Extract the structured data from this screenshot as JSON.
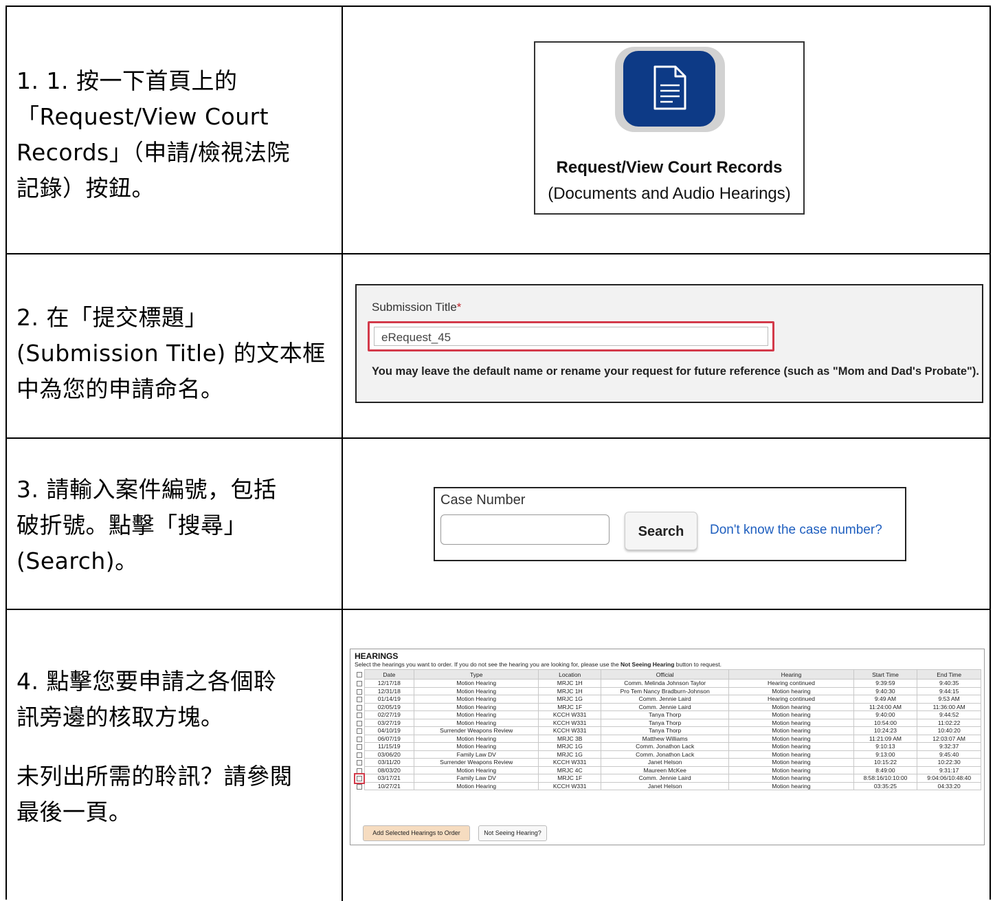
{
  "steps": [
    {
      "lines": [
        "1.  1. 按一下首頁上的",
        "「Request/View Court",
        "Records」（申請/檢視法院",
        "記錄）按鈕。"
      ]
    },
    {
      "lines": [
        "2.   在「提交標題」",
        "(Submission Title) 的文本框",
        "中為您的申請命名。"
      ]
    },
    {
      "lines": [
        "3.   請輸入案件編號，包括",
        "破折號。點擊「搜尋」",
        "(Search)。"
      ]
    },
    {
      "lines": [
        "4.   點擊您要申請之各個聆",
        "訊旁邊的核取方塊。"
      ],
      "lines2": [
        "未列出所需的聆訊？請參閱",
        "最後一頁。"
      ]
    }
  ],
  "request_view": {
    "icon": "document-icon",
    "title": "Request/View Court Records",
    "subtitle": "(Documents and Audio Hearings)"
  },
  "submission": {
    "label": "Submission Title",
    "required_mark": "*",
    "value": "eRequest_45",
    "help": "You may leave the default name or rename your request for future reference (such as \"Mom and Dad's Probate\")."
  },
  "case_search": {
    "label": "Case Number",
    "input_value": "",
    "search_button": "Search",
    "help_link": "Don't know the case number?"
  },
  "hearings": {
    "title": "HEARINGS",
    "desc_before": "Select the hearings you want to order. If you do not see the hearing you are looking for, please use the ",
    "desc_bold": "Not Seeing Hearing",
    "desc_after": " button to request.",
    "columns": [
      "Date",
      "Type",
      "Location",
      "Official",
      "Hearing",
      "Start Time",
      "End Time"
    ],
    "rows": [
      [
        "12/17/18",
        "Motion Hearing",
        "MRJC 1H",
        "Comm. Melinda Johnson Taylor",
        "Hearing continued",
        "9:39:59",
        "9:40:35"
      ],
      [
        "12/31/18",
        "Motion Hearing",
        "MRJC 1H",
        "Pro Tem Nancy Bradburn-Johnson",
        "Motion hearing",
        "9:40:30",
        "9:44:15"
      ],
      [
        "01/14/19",
        "Motion Hearing",
        "MRJC 1G",
        "Comm. Jennie Laird",
        "Hearing continued",
        "9:49 AM",
        "9:53 AM"
      ],
      [
        "02/05/19",
        "Motion Hearing",
        "MRJC 1F",
        "Comm. Jennie Laird",
        "Motion hearing",
        "11:24:00 AM",
        "11:36:00 AM"
      ],
      [
        "02/27/19",
        "Motion Hearing",
        "KCCH W331",
        "Tanya Thorp",
        "Motion hearing",
        "9:40:00",
        "9:44:52"
      ],
      [
        "03/27/19",
        "Motion Hearing",
        "KCCH W331",
        "Tanya Thorp",
        "Motion hearing",
        "10:54:00",
        "11:02:22"
      ],
      [
        "04/10/19",
        "Surrender Weapons Review",
        "KCCH W331",
        "Tanya Thorp",
        "Motion hearing",
        "10:24:23",
        "10:40:20"
      ],
      [
        "06/07/19",
        "Motion Hearing",
        "MRJC 3B",
        "Matthew Williams",
        "Motion hearing",
        "11:21:09 AM",
        "12:03:07 AM"
      ],
      [
        "11/15/19",
        "Motion Hearing",
        "MRJC 1G",
        "Comm. Jonathon Lack",
        "Motion hearing",
        "9:10:13",
        "9:32:37"
      ],
      [
        "03/06/20",
        "Family Law DV",
        "MRJC 1G",
        "Comm. Jonathon Lack",
        "Motion hearing",
        "9:13:00",
        "9:45:40"
      ],
      [
        "03/11/20",
        "Surrender Weapons Review",
        "KCCH W331",
        "Janet Helson",
        "Motion hearing",
        "10:15:22",
        "10:22:30"
      ],
      [
        "08/03/20",
        "Motion Hearing",
        "MRJC 4C",
        "Maureen McKee",
        "Motion hearing",
        "8:49:00",
        "9:31:17"
      ],
      [
        "03/17/21",
        "Family Law DV",
        "MRJC 1F",
        "Comm. Jennie Laird",
        "Motion hearing",
        "8:58:16/10:10:00",
        "9:04:06/10:48:40"
      ],
      [
        "10/27/21",
        "Motion Hearing",
        "KCCH W331",
        "Janet Helson",
        "Motion hearing",
        "03:35:25",
        "04:33:20"
      ]
    ],
    "add_button": "Add Selected Hearings to Order",
    "not_seeing_button": "Not Seeing Hearing?"
  }
}
